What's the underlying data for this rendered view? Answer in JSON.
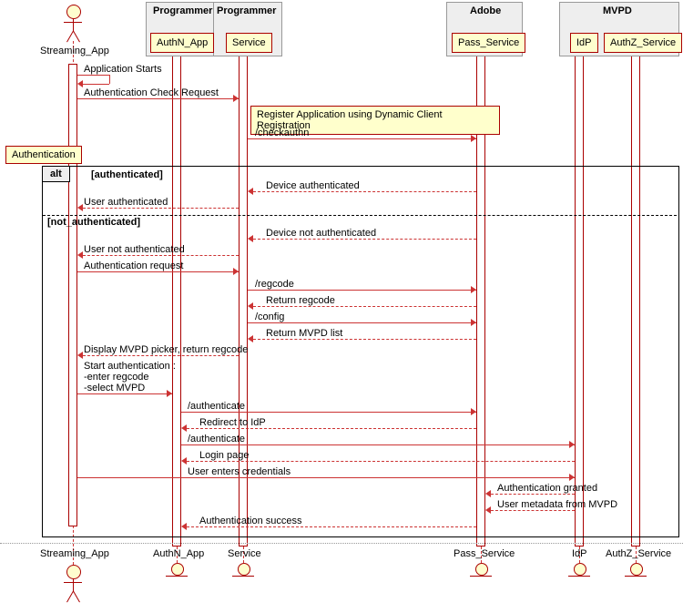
{
  "participants": {
    "actor1_label": "Streaming_App",
    "prog_group": "Programmer",
    "authn_label": "AuthN_App",
    "service_label": "Service",
    "adobe_group": "Adobe",
    "pass_label": "Pass_Service",
    "mvpd_group": "MVPD",
    "idp_label": "IdP",
    "authz_label": "AuthZ_Service"
  },
  "notes": {
    "register": "Register Application using Dynamic Client Registration",
    "authn_tag": "Authentication"
  },
  "frame": {
    "tag": "alt",
    "cond1": "[authenticated]",
    "cond2": "[not_authenticated]"
  },
  "messages": {
    "m1": "Application Starts",
    "m2": "Authentication Check Request",
    "m3": "/checkauthn",
    "m4": "Device authenticated",
    "m5": "User authenticated",
    "m6": "Device not authenticated",
    "m7": "User not authenticated",
    "m8": "Authentication request",
    "m9": "/regcode",
    "m10": "Return regcode",
    "m11": "/config",
    "m12": "Return MVPD list",
    "m13": "Display MVPD picker, return regcode",
    "m14a": "Start authentication :",
    "m14b": "-enter regcode",
    "m14c": "-select MVPD",
    "m15": "/authenticate",
    "m16": "Redirect to IdP",
    "m17": "/authenticate",
    "m18": "Login page",
    "m19": "User enters credentials",
    "m20": "Authentication granted",
    "m21": "User metadata from MVPD",
    "m22": "Authentication success"
  },
  "chart_data": {
    "type": "sequence_diagram",
    "participants": [
      {
        "name": "Streaming_App",
        "kind": "actor"
      },
      {
        "name": "AuthN_App",
        "group": "Programmer"
      },
      {
        "name": "Service",
        "group": "Programmer"
      },
      {
        "name": "Pass_Service",
        "group": "Adobe"
      },
      {
        "name": "IdP",
        "group": "MVPD"
      },
      {
        "name": "AuthZ_Service",
        "group": "MVPD"
      }
    ],
    "messages": [
      {
        "from": "Streaming_App",
        "to": "Streaming_App",
        "text": "Application Starts"
      },
      {
        "from": "Streaming_App",
        "to": "Service",
        "text": "Authentication Check Request"
      },
      {
        "note": "Register Application using Dynamic Client Registration",
        "over": [
          "Service",
          "Pass_Service"
        ]
      },
      {
        "from": "Service",
        "to": "Pass_Service",
        "text": "/checkauthn"
      },
      {
        "alt": "authenticated",
        "messages": [
          {
            "from": "Pass_Service",
            "to": "Service",
            "text": "Device authenticated",
            "return": true
          },
          {
            "from": "Service",
            "to": "Streaming_App",
            "text": "User authenticated",
            "return": true
          }
        ]
      },
      {
        "else": "not_authenticated",
        "messages": [
          {
            "from": "Pass_Service",
            "to": "Service",
            "text": "Device not authenticated",
            "return": true
          },
          {
            "from": "Service",
            "to": "Streaming_App",
            "text": "User not authenticated",
            "return": true
          },
          {
            "from": "Streaming_App",
            "to": "Service",
            "text": "Authentication request"
          },
          {
            "from": "Service",
            "to": "Pass_Service",
            "text": "/regcode"
          },
          {
            "from": "Pass_Service",
            "to": "Service",
            "text": "Return regcode",
            "return": true
          },
          {
            "from": "Service",
            "to": "Pass_Service",
            "text": "/config"
          },
          {
            "from": "Pass_Service",
            "to": "Service",
            "text": "Return MVPD list",
            "return": true
          },
          {
            "from": "Service",
            "to": "Streaming_App",
            "text": "Display MVPD picker, return regcode",
            "return": true
          },
          {
            "from": "Streaming_App",
            "to": "AuthN_App",
            "text": "Start authentication :\n-enter regcode\n-select MVPD"
          },
          {
            "from": "AuthN_App",
            "to": "Pass_Service",
            "text": "/authenticate"
          },
          {
            "from": "Pass_Service",
            "to": "AuthN_App",
            "text": "Redirect to IdP",
            "return": true
          },
          {
            "from": "AuthN_App",
            "to": "IdP",
            "text": "/authenticate"
          },
          {
            "from": "IdP",
            "to": "AuthN_App",
            "text": "Login page",
            "return": true
          },
          {
            "from": "Streaming_App",
            "to": "IdP",
            "text": "User enters credentials"
          },
          {
            "from": "IdP",
            "to": "Pass_Service",
            "text": "Authentication granted",
            "return": true
          },
          {
            "from": "IdP",
            "to": "Pass_Service",
            "text": "User metadata from MVPD",
            "return": true
          },
          {
            "from": "Pass_Service",
            "to": "AuthN_App",
            "text": "Authentication success",
            "return": true
          }
        ]
      }
    ]
  }
}
